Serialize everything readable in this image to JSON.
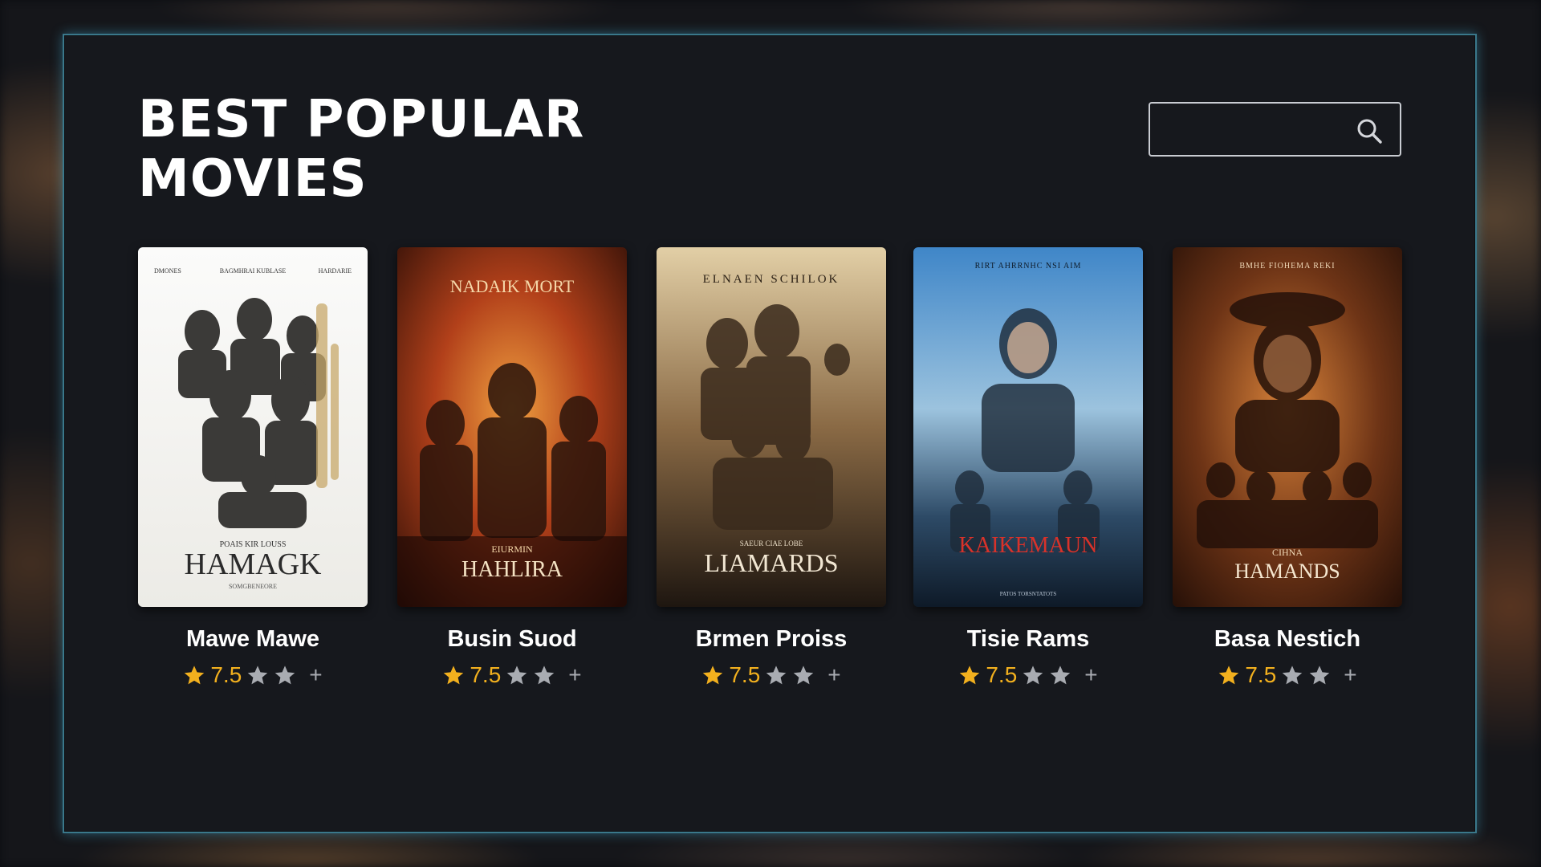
{
  "page": {
    "title_line1": "BEST POPULAR",
    "title_line2": "MOVIES"
  },
  "search": {
    "placeholder": "",
    "icon": "search-icon"
  },
  "colors": {
    "accent_border": "#5ac8e6",
    "star": "#f2b01e",
    "star_dim": "#a9acb2"
  },
  "movies": [
    {
      "name": "Mawe Mawe",
      "rating": "7.5",
      "add": "+",
      "poster": {
        "header_left": "DMONES",
        "header_center": "BAGMHRAI KUBLASE",
        "header_right": "HARDARIE",
        "title_small": "POAIS KIR LOUSS",
        "title": "HAMAGK",
        "footer": "SOMGBENEORE",
        "theme": "white"
      }
    },
    {
      "name": "Busin Suod",
      "rating": "7.5",
      "add": "+",
      "poster": {
        "header": "NADAIK MORT",
        "title_small": "EIURMIN",
        "title": "HAHLIRA",
        "theme": "fire"
      }
    },
    {
      "name": "Brmen Proiss",
      "rating": "7.5",
      "add": "+",
      "poster": {
        "header": "ELNAEN SCHILOK",
        "title_small": "SAEUR CIAE LOBE",
        "title": "LIAMARDS",
        "theme": "sepia"
      }
    },
    {
      "name": "Tisie Rams",
      "rating": "7.5",
      "add": "+",
      "poster": {
        "header": "RIRT AHRRNHC NSI AIM",
        "title": "KAIKEMAUN",
        "footer": "PATOS TORSNTATOTS",
        "theme": "blue"
      }
    },
    {
      "name": "Basa Nestich",
      "rating": "7.5",
      "add": "+",
      "poster": {
        "header": "BMHE FIOHEMA REKI",
        "title_small": "CIHNA",
        "title": "HAMANDS",
        "theme": "amber"
      }
    }
  ]
}
